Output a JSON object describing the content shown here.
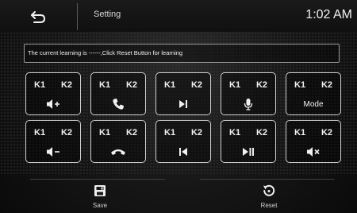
{
  "header": {
    "title": "Setting",
    "clock": "1:02 AM",
    "back_icon": "back-arrow-icon"
  },
  "notice": "The current learning is ------,Click Reset Button for learning",
  "keys": [
    {
      "k1": "K1",
      "k2": "K2",
      "icon": "volume-up-icon"
    },
    {
      "k1": "K1",
      "k2": "K2",
      "icon": "phone-answer-icon"
    },
    {
      "k1": "K1",
      "k2": "K2",
      "icon": "next-track-icon"
    },
    {
      "k1": "K1",
      "k2": "K2",
      "icon": "microphone-icon"
    },
    {
      "k1": "K1",
      "k2": "K2",
      "label": "Mode",
      "icon": "mode-label"
    },
    {
      "k1": "K1",
      "k2": "K2",
      "icon": "volume-down-icon"
    },
    {
      "k1": "K1",
      "k2": "K2",
      "icon": "phone-hangup-icon"
    },
    {
      "k1": "K1",
      "k2": "K2",
      "icon": "previous-track-icon"
    },
    {
      "k1": "K1",
      "k2": "K2",
      "icon": "play-pause-icon"
    },
    {
      "k1": "K1",
      "k2": "K2",
      "icon": "mute-icon"
    }
  ],
  "footer": {
    "save_label": "Save",
    "save_icon": "save-icon",
    "reset_label": "Reset",
    "reset_icon": "reset-icon"
  }
}
